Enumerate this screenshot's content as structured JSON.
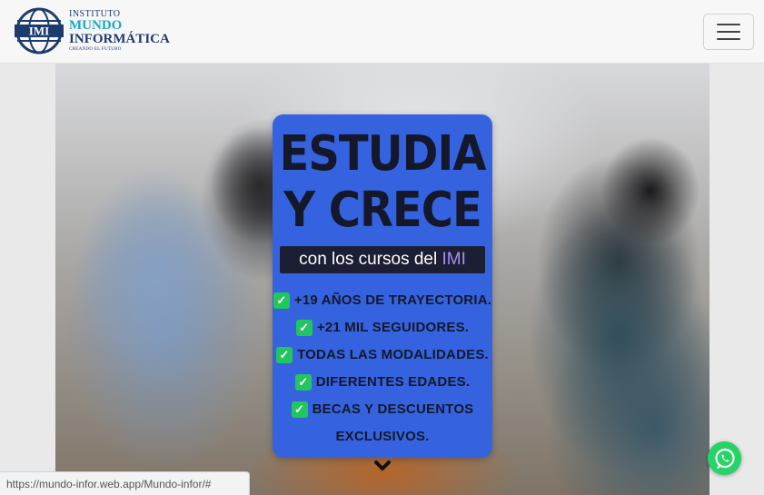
{
  "brand": {
    "logo_mark": "IMI",
    "line1": "INSTITUTO",
    "line2": "MUNDO",
    "line3": "INFORMÁTICA",
    "tagline": "CREANDO EL FUTURO"
  },
  "nav": {
    "toggler_icon": "hamburger-menu-icon"
  },
  "promo": {
    "title_line1": "ESTUDIA",
    "title_line2": "Y CRECE",
    "subtitle_prefix": "con los cursos del ",
    "subtitle_highlight": "IMI",
    "features": [
      "+19 AÑOS DE TRAYECTORIA.",
      "+21 MIL SEGUIDORES.",
      "TODAS LAS MODALIDADES.",
      "DIFERENTES EDADES.",
      "BECAS Y DESCUENTOS"
    ],
    "features_continuation": "EXCLUSIVOS.",
    "check_icon": "check-icon"
  },
  "status_bar": {
    "url": "https://mundo-infor.web.app/Mundo-infor/#"
  },
  "floating": {
    "whatsapp_icon": "whatsapp-icon"
  },
  "colors": {
    "promo_bg": "#3563e0",
    "title_color": "#15182b",
    "highlight": "#a98df0",
    "check_green": "#22c55e",
    "whatsapp_green": "#25d366"
  }
}
